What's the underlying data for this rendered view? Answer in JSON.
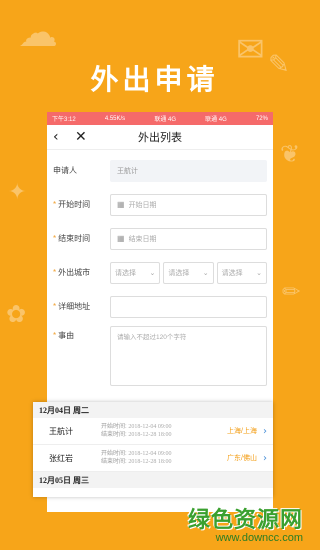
{
  "banner": {
    "title": "外出申请"
  },
  "status_bar": {
    "time": "下午3:12",
    "speed": "4.55K/s",
    "carrier1": "联通 4G",
    "carrier2": "联通 4G",
    "battery": "72%"
  },
  "nav": {
    "back_icon": "back-arrow-icon",
    "close_icon": "close-icon",
    "title": "外出列表"
  },
  "form": {
    "applicant": {
      "label": "申请人",
      "value": "王航计"
    },
    "start_time": {
      "label": "开始时间",
      "placeholder": "开始日期"
    },
    "end_time": {
      "label": "结束时间",
      "placeholder": "结束日期"
    },
    "city": {
      "label": "外出城市",
      "select1": "请选择",
      "select2": "请选择",
      "select3": "请选择"
    },
    "address": {
      "label": "详细地址",
      "value": ""
    },
    "reason": {
      "label": "事由",
      "placeholder": "请输入不超过120个字符"
    }
  },
  "list": {
    "group1_header": "12月04日 周二",
    "items": [
      {
        "name": "王航计",
        "start_label": "开始时间:",
        "start": "2018-12-04 09:00",
        "end_label": "结束时间:",
        "end": "2018-12-28 18:00",
        "city": "上海/上海"
      },
      {
        "name": "张红岩",
        "start_label": "开始时间:",
        "start": "2018-12-04 09:00",
        "end_label": "结束时间:",
        "end": "2018-12-28 18:00",
        "city": "广东/佛山"
      }
    ],
    "group2_header": "12月05日 周三"
  },
  "watermark": {
    "line1": "绿色资源网",
    "line2": "www.downcc.com"
  },
  "colors": {
    "background": "#f7a519",
    "status_bar": "#f56a6a",
    "accent": "#f39c12",
    "chevron": "#4a90d9"
  }
}
